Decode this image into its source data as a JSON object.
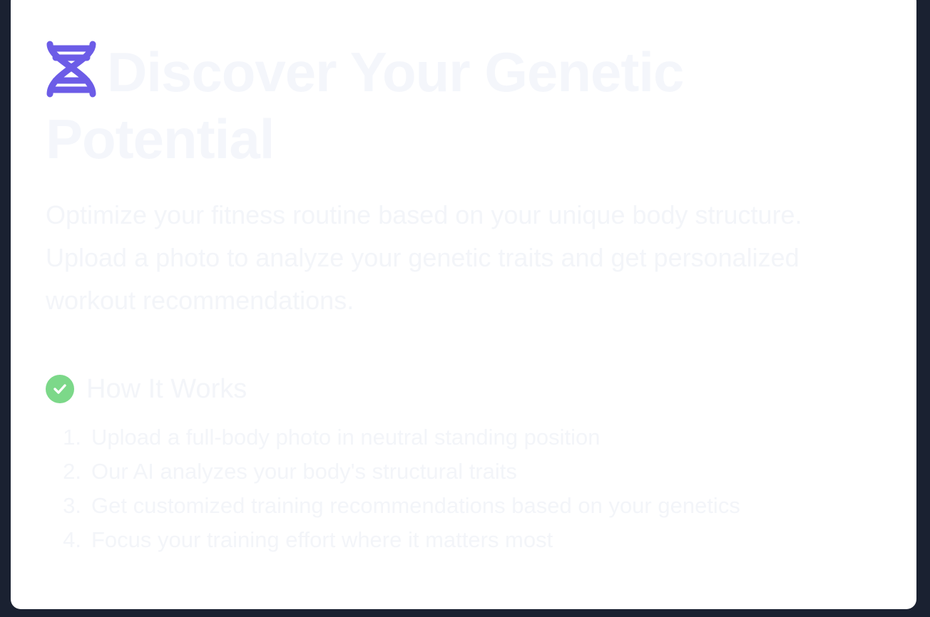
{
  "hero": {
    "title": "Discover Your Genetic Potential",
    "description": "Optimize your fitness routine based on your unique body structure. Upload a photo to analyze your genetic traits and get personalized workout recommendations."
  },
  "how_it_works": {
    "title": "How It Works",
    "steps": [
      {
        "number": "1.",
        "text": "Upload a full-body photo in neutral standing position"
      },
      {
        "number": "2.",
        "text": "Our AI analyzes your body's structural traits"
      },
      {
        "number": "3.",
        "text": "Get customized training recommendations based on your genetics"
      },
      {
        "number": "4.",
        "text": "Focus your training effort where it matters most"
      }
    ]
  },
  "colors": {
    "background": "#1a2131",
    "card": "#ffffff",
    "dna_icon": "#6c5ce7",
    "check_icon": "#7cd889",
    "text_faded": "#f3f5f9"
  },
  "icons": {
    "hero": "dna-icon",
    "how_it_works": "check-circle-icon"
  }
}
